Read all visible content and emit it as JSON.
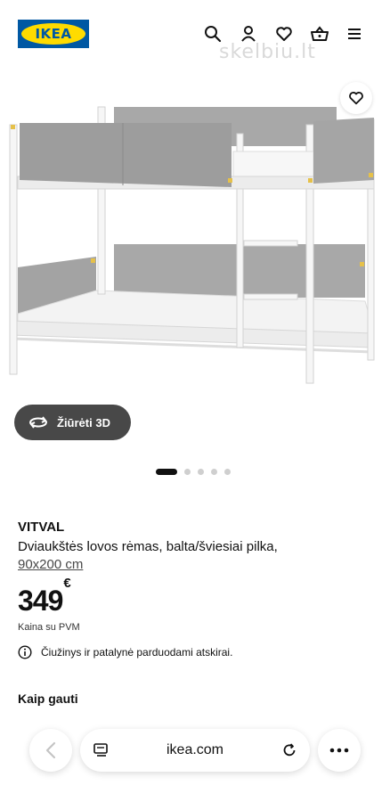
{
  "header": {
    "logo_text": "IKEA",
    "watermark": "skelbiu.lt",
    "icons": [
      "search-icon",
      "profile-icon",
      "heart-icon",
      "basket-icon",
      "menu-icon"
    ]
  },
  "hero": {
    "view3d_label": "Žiūrėti 3D",
    "carousel_total": 5,
    "carousel_active": 1
  },
  "product": {
    "name": "VITVAL",
    "description": "Dviaukštės lovos rėmas, balta/šviesiai pilka,",
    "size": "90x200 cm",
    "price": "349",
    "currency": "€",
    "price_note": "Kaina su PVM",
    "info_text": "Čiužinys ir patalynė parduodami atskirai.",
    "how_to_get": "Kaip gauti"
  },
  "browser": {
    "url": "ikea.com"
  },
  "colors": {
    "brand_blue": "#0058a3",
    "brand_yellow": "#ffdb00",
    "button_dark": "#484848"
  }
}
